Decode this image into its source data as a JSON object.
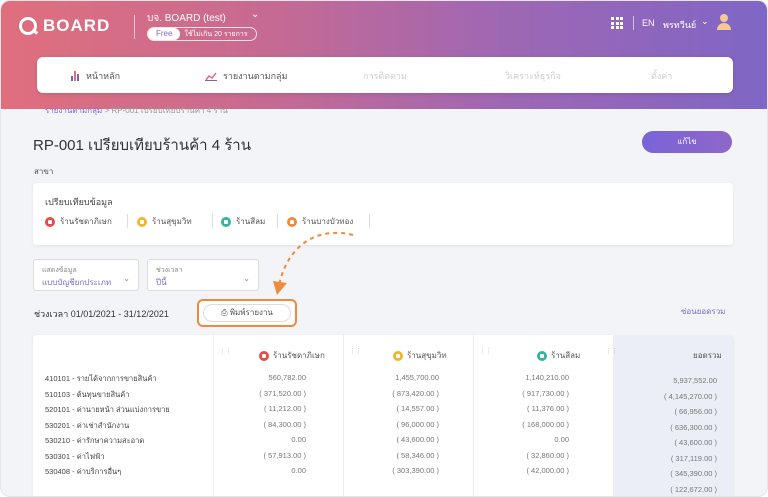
{
  "app": {
    "logo_text": "BOARD",
    "company": "บจ. BOARD (test)",
    "plan_badge": "Free",
    "plan_text": "ใช้ไม่เกิน 20 รายการ",
    "lang": "EN",
    "user_name": "พรทวีนย์"
  },
  "nav": {
    "items": [
      {
        "label": "หน้าหลัก"
      },
      {
        "label": "รายงานตามกลุ่ม"
      },
      {
        "label": "การติดตาม"
      },
      {
        "label": "วิเคราะห์ธุรกิจ"
      },
      {
        "label": "ตั้งค่า"
      }
    ]
  },
  "breadcrumb": {
    "parent": "รายงานตามกลุ่ม",
    "separator": ">",
    "current": "RP-001 เปรียบเทียบร้านค้า 4 ร้าน"
  },
  "page": {
    "title": "RP-001 เปรียบเทียบร้านค้า 4 ร้าน",
    "edit_label": "แก้ไข",
    "branch_label": "สาขา"
  },
  "compare": {
    "title": "เปรียบเทียบข้อมูล",
    "stores": [
      {
        "name": "ร้านรัชดาภิเษก",
        "color": "#e84b4b"
      },
      {
        "name": "ร้านสุขุมวิท",
        "color": "#f1b52e"
      },
      {
        "name": "ร้านสีลม",
        "color": "#38b3a1"
      },
      {
        "name": "ร้านบางบัวทอง",
        "color": "#f08a3c"
      }
    ]
  },
  "filters": {
    "display_label": "แสดงข้อมูล",
    "display_value": "แบบบัญชียกประเภท",
    "period_label": "ช่วงเวลา",
    "period_value": "ปีนี้"
  },
  "report": {
    "period_text": "ช่วงเวลา 01/01/2021 - 31/12/2021",
    "print_label": "พิมพ์รายงาน",
    "sum_link": "ซ่อนยอดรวม",
    "total_header": "ยอดรวม",
    "columns": [
      "ร้านรัชดาภิเษก",
      "ร้านสุขุมวิท",
      "ร้านสีลม"
    ],
    "rows": [
      {
        "label": "410101 - รายได้จากการขายสินค้า",
        "values": [
          "560,782.00",
          "1,455,700.00",
          "1,140,210.00"
        ],
        "total": "5,937,552.00"
      },
      {
        "label": "510103 - ต้นทุนขายสินค้า",
        "values": [
          "( 371,520.00 )",
          "( 873,420.00 )",
          "( 917,730.00 )"
        ],
        "total": "( 4,145,270.00 )"
      },
      {
        "label": "520101 - ค่านายหน้า ส่วนแบ่งการขาย",
        "values": [
          "( 11,212.00 )",
          "( 14,557.00 )",
          "( 11,376.00 )"
        ],
        "total": "( 66,956.00 )"
      },
      {
        "label": "530201 - ค่าเช่าสำนักงาน",
        "values": [
          "( 84,300.00 )",
          "( 96,000.00 )",
          "( 168,000.00 )"
        ],
        "total": "( 636,300.00 )"
      },
      {
        "label": "530210 - ค่ารักษาความสะอาด",
        "values": [
          "0.00",
          "( 43,600.00 )",
          "0.00"
        ],
        "total": "( 43,600.00 )"
      },
      {
        "label": "530301 - ค่าไฟฟ้า",
        "values": [
          "( 57,913.00 )",
          "( 58,346.00 )",
          "( 32,860.00 )"
        ],
        "total": "( 317,119.00 )"
      },
      {
        "label": "530408 - ค่าบริการอื่นๆ",
        "values": [
          "0.00",
          "( 303,390.00 )",
          "( 42,000.00 )"
        ],
        "total": "( 345,390.00 )"
      },
      {
        "label": "",
        "values": [
          "",
          "",
          ""
        ],
        "total": "( 122,672.00 )"
      }
    ]
  }
}
